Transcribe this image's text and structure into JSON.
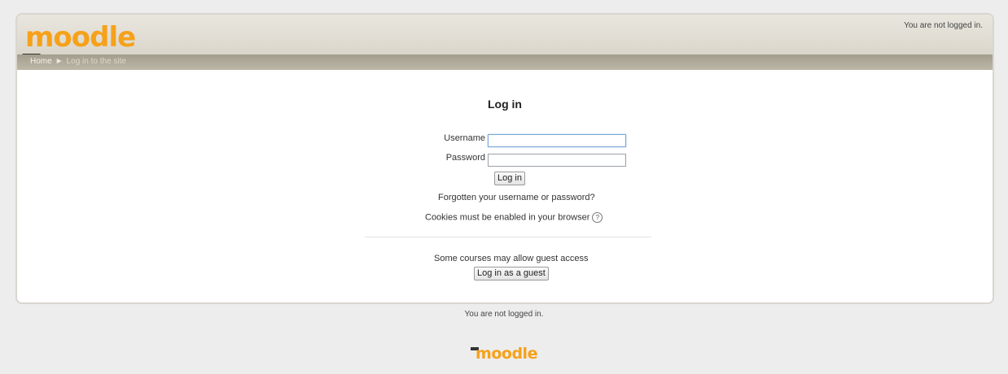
{
  "header": {
    "logo_text": "moodle",
    "login_status": "You are not logged in."
  },
  "breadcrumb": {
    "home": "Home",
    "separator": "►",
    "current": "Log in to the site"
  },
  "login": {
    "title": "Log in",
    "username_label": "Username",
    "username_value": "",
    "password_label": "Password",
    "password_value": "",
    "submit_label": "Log in",
    "forgot_link": "Forgotten your username or password?",
    "cookies_text": "Cookies must be enabled in your browser",
    "help_icon": "?",
    "guest_text": "Some courses may allow guest access",
    "guest_button": "Log in as a guest"
  },
  "footer": {
    "login_status": "You are not logged in.",
    "logo_text": "moodle"
  },
  "colors": {
    "brand_orange": "#f6a11a",
    "header_bg": "#ddd9cf",
    "navbar_bg": "#b0aa9a"
  },
  "icons": {
    "logo": "moodle-logo-icon",
    "help": "help-icon"
  }
}
